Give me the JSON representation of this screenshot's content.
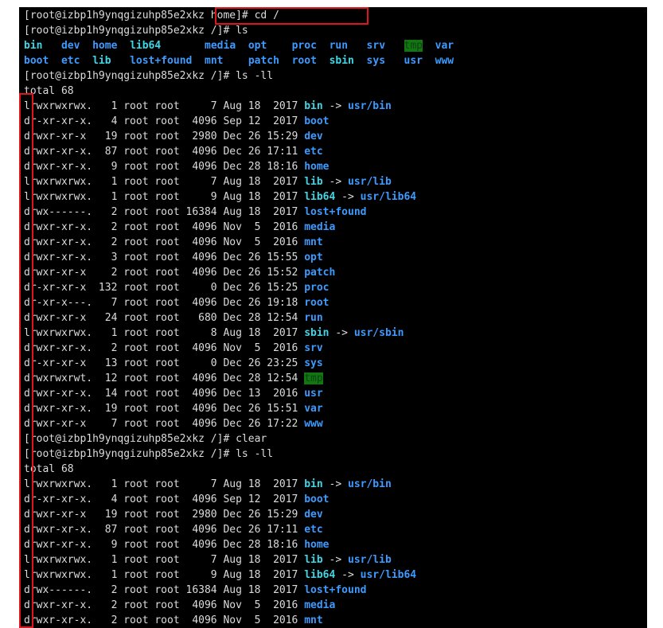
{
  "colors": {
    "background": "#000000",
    "text": "#dcdcdc",
    "directory": "#3d9bff",
    "symlink": "#3fd6e6",
    "highlight": "#11780f",
    "annotation": "#e0141b"
  },
  "lines": [
    [
      {
        "t": "[root@izbp1h9ynqgizuhp85e2xkz home]# cd /"
      }
    ],
    [
      {
        "t": "[root@izbp1h9ynqgizuhp85e2xkz /]# ls"
      }
    ],
    [
      {
        "t": "bin",
        "c": "link"
      },
      {
        "t": "   "
      },
      {
        "t": "dev",
        "c": "dir"
      },
      {
        "t": "  "
      },
      {
        "t": "home",
        "c": "dir"
      },
      {
        "t": "  "
      },
      {
        "t": "lib64",
        "c": "link"
      },
      {
        "t": "       "
      },
      {
        "t": "media",
        "c": "dir"
      },
      {
        "t": "  "
      },
      {
        "t": "opt",
        "c": "dir"
      },
      {
        "t": "    "
      },
      {
        "t": "proc",
        "c": "dir"
      },
      {
        "t": "  "
      },
      {
        "t": "run",
        "c": "dir"
      },
      {
        "t": "   "
      },
      {
        "t": "srv",
        "c": "dir"
      },
      {
        "t": "   "
      },
      {
        "t": "tmp",
        "c": "hl"
      },
      {
        "t": "  "
      },
      {
        "t": "var",
        "c": "dir"
      }
    ],
    [
      {
        "t": "boot",
        "c": "dir"
      },
      {
        "t": "  "
      },
      {
        "t": "etc",
        "c": "dir"
      },
      {
        "t": "  "
      },
      {
        "t": "lib",
        "c": "link"
      },
      {
        "t": "   "
      },
      {
        "t": "lost+found",
        "c": "dir"
      },
      {
        "t": "  "
      },
      {
        "t": "mnt",
        "c": "dir"
      },
      {
        "t": "    "
      },
      {
        "t": "patch",
        "c": "dir"
      },
      {
        "t": "  "
      },
      {
        "t": "root",
        "c": "dir"
      },
      {
        "t": "  "
      },
      {
        "t": "sbin",
        "c": "link"
      },
      {
        "t": "  "
      },
      {
        "t": "sys",
        "c": "dir"
      },
      {
        "t": "   "
      },
      {
        "t": "usr",
        "c": "dir"
      },
      {
        "t": "  "
      },
      {
        "t": "www",
        "c": "dir"
      }
    ],
    [
      {
        "t": "[root@izbp1h9ynqgizuhp85e2xkz /]# ls -ll"
      }
    ],
    [
      {
        "t": "total 68"
      }
    ],
    [
      {
        "t": "lrwxrwxrwx.   1 root root     7 Aug 18  2017 "
      },
      {
        "t": "bin",
        "c": "link"
      },
      {
        "t": " -> "
      },
      {
        "t": "usr/bin",
        "c": "dir"
      }
    ],
    [
      {
        "t": "dr-xr-xr-x.   4 root root  4096 Sep 12  2017 "
      },
      {
        "t": "boot",
        "c": "dir"
      }
    ],
    [
      {
        "t": "drwxr-xr-x   19 root root  2980 Dec 26 15:29 "
      },
      {
        "t": "dev",
        "c": "dir"
      }
    ],
    [
      {
        "t": "drwxr-xr-x.  87 root root  4096 Dec 26 17:11 "
      },
      {
        "t": "etc",
        "c": "dir"
      }
    ],
    [
      {
        "t": "drwxr-xr-x.   9 root root  4096 Dec 28 18:16 "
      },
      {
        "t": "home",
        "c": "dir"
      }
    ],
    [
      {
        "t": "lrwxrwxrwx.   1 root root     7 Aug 18  2017 "
      },
      {
        "t": "lib",
        "c": "link"
      },
      {
        "t": " -> "
      },
      {
        "t": "usr/lib",
        "c": "dir"
      }
    ],
    [
      {
        "t": "lrwxrwxrwx.   1 root root     9 Aug 18  2017 "
      },
      {
        "t": "lib64",
        "c": "link"
      },
      {
        "t": " -> "
      },
      {
        "t": "usr/lib64",
        "c": "dir"
      }
    ],
    [
      {
        "t": "drwx------.   2 root root 16384 Aug 18  2017 "
      },
      {
        "t": "lost+found",
        "c": "dir"
      }
    ],
    [
      {
        "t": "drwxr-xr-x.   2 root root  4096 Nov  5  2016 "
      },
      {
        "t": "media",
        "c": "dir"
      }
    ],
    [
      {
        "t": "drwxr-xr-x.   2 root root  4096 Nov  5  2016 "
      },
      {
        "t": "mnt",
        "c": "dir"
      }
    ],
    [
      {
        "t": "drwxr-xr-x.   3 root root  4096 Dec 26 15:55 "
      },
      {
        "t": "opt",
        "c": "dir"
      }
    ],
    [
      {
        "t": "drwxr-xr-x    2 root root  4096 Dec 26 15:52 "
      },
      {
        "t": "patch",
        "c": "dir"
      }
    ],
    [
      {
        "t": "dr-xr-xr-x  132 root root     0 Dec 26 15:25 "
      },
      {
        "t": "proc",
        "c": "dir"
      }
    ],
    [
      {
        "t": "dr-xr-x---.   7 root root  4096 Dec 26 19:18 "
      },
      {
        "t": "root",
        "c": "dir"
      }
    ],
    [
      {
        "t": "drwxr-xr-x   24 root root   680 Dec 28 12:54 "
      },
      {
        "t": "run",
        "c": "dir"
      }
    ],
    [
      {
        "t": "lrwxrwxrwx.   1 root root     8 Aug 18  2017 "
      },
      {
        "t": "sbin",
        "c": "link"
      },
      {
        "t": " -> "
      },
      {
        "t": "usr/sbin",
        "c": "dir"
      }
    ],
    [
      {
        "t": "drwxr-xr-x.   2 root root  4096 Nov  5  2016 "
      },
      {
        "t": "srv",
        "c": "dir"
      }
    ],
    [
      {
        "t": "dr-xr-xr-x   13 root root     0 Dec 26 23:25 "
      },
      {
        "t": "sys",
        "c": "dir"
      }
    ],
    [
      {
        "t": "drwxrwxrwt.  12 root root  4096 Dec 28 12:54 "
      },
      {
        "t": "tmp",
        "c": "hl"
      }
    ],
    [
      {
        "t": "drwxr-xr-x.  14 root root  4096 Dec 13  2016 "
      },
      {
        "t": "usr",
        "c": "dir"
      }
    ],
    [
      {
        "t": "drwxr-xr-x.  19 root root  4096 Dec 26 15:51 "
      },
      {
        "t": "var",
        "c": "dir"
      }
    ],
    [
      {
        "t": "drwxr-xr-x    7 root root  4096 Dec 26 17:22 "
      },
      {
        "t": "www",
        "c": "dir"
      }
    ],
    [
      {
        "t": "[root@izbp1h9ynqgizuhp85e2xkz /]# clear"
      }
    ],
    [
      {
        "t": "[root@izbp1h9ynqgizuhp85e2xkz /]# ls -ll"
      }
    ],
    [
      {
        "t": "total 68"
      }
    ],
    [
      {
        "t": "lrwxrwxrwx.   1 root root     7 Aug 18  2017 "
      },
      {
        "t": "bin",
        "c": "link"
      },
      {
        "t": " -> "
      },
      {
        "t": "usr/bin",
        "c": "dir"
      }
    ],
    [
      {
        "t": "dr-xr-xr-x.   4 root root  4096 Sep 12  2017 "
      },
      {
        "t": "boot",
        "c": "dir"
      }
    ],
    [
      {
        "t": "drwxr-xr-x   19 root root  2980 Dec 26 15:29 "
      },
      {
        "t": "dev",
        "c": "dir"
      }
    ],
    [
      {
        "t": "drwxr-xr-x.  87 root root  4096 Dec 26 17:11 "
      },
      {
        "t": "etc",
        "c": "dir"
      }
    ],
    [
      {
        "t": "drwxr-xr-x.   9 root root  4096 Dec 28 18:16 "
      },
      {
        "t": "home",
        "c": "dir"
      }
    ],
    [
      {
        "t": "lrwxrwxrwx.   1 root root     7 Aug 18  2017 "
      },
      {
        "t": "lib",
        "c": "link"
      },
      {
        "t": " -> "
      },
      {
        "t": "usr/lib",
        "c": "dir"
      }
    ],
    [
      {
        "t": "lrwxrwxrwx.   1 root root     9 Aug 18  2017 "
      },
      {
        "t": "lib64",
        "c": "link"
      },
      {
        "t": " -> "
      },
      {
        "t": "usr/lib64",
        "c": "dir"
      }
    ],
    [
      {
        "t": "drwx------.   2 root root 16384 Aug 18  2017 "
      },
      {
        "t": "lost+found",
        "c": "dir"
      }
    ],
    [
      {
        "t": "drwxr-xr-x.   2 root root  4096 Nov  5  2016 "
      },
      {
        "t": "media",
        "c": "dir"
      }
    ],
    [
      {
        "t": "drwxr-xr-x.   2 root root  4096 Nov  5  2016 "
      },
      {
        "t": "mnt",
        "c": "dir"
      }
    ]
  ]
}
